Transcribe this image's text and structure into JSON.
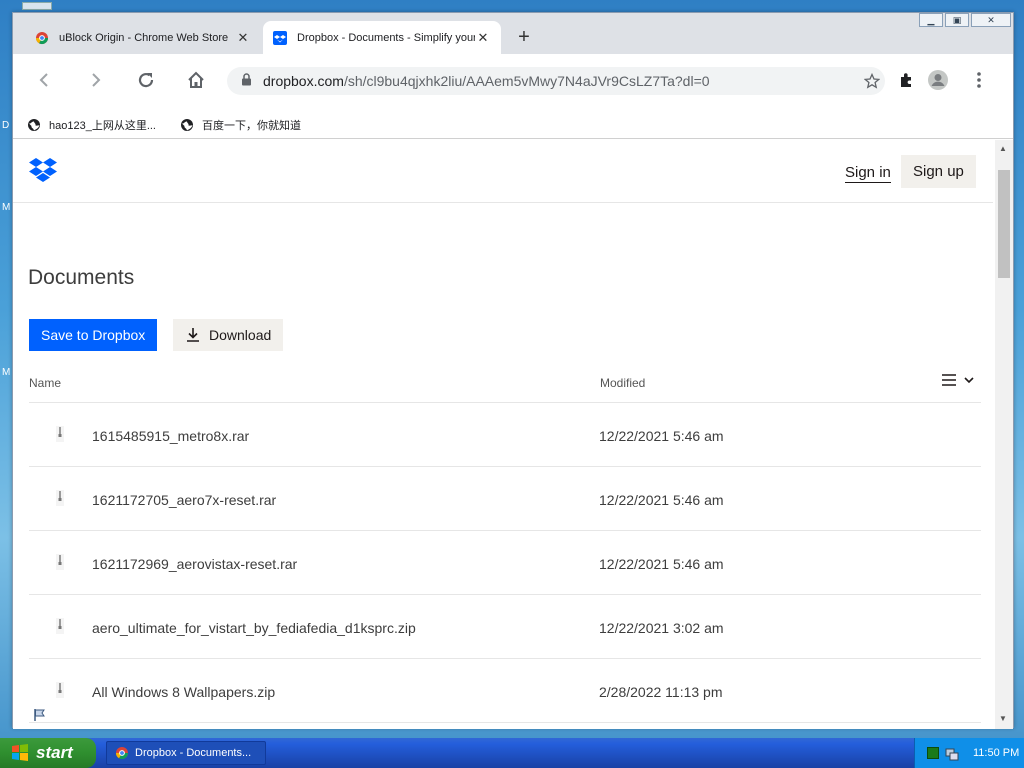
{
  "browser": {
    "tabs": [
      {
        "title": "uBlock Origin - Chrome Web Store",
        "active": false
      },
      {
        "title": "Dropbox - Documents - Simplify your",
        "active": true
      }
    ],
    "new_tab": "+",
    "url_host": "dropbox.com",
    "url_path": "/sh/cl9bu4qjxhk2liu/AAAem5vMwy7N4aJVr9CsLZ7Ta?dl=0",
    "bookmarks": [
      {
        "label": "hao123_上网从这里..."
      },
      {
        "label": "百度一下，你就知道"
      }
    ]
  },
  "dropbox": {
    "sign_in": "Sign in",
    "sign_up": "Sign up",
    "title": "Documents",
    "save_button": "Save to Dropbox",
    "download_button": "Download",
    "columns": {
      "name": "Name",
      "modified": "Modified"
    },
    "files": [
      {
        "name": "1615485915_metro8x.rar",
        "modified": "12/22/2021 5:46 am"
      },
      {
        "name": "1621172705_aero7x-reset.rar",
        "modified": "12/22/2021 5:46 am"
      },
      {
        "name": "1621172969_aerovistax-reset.rar",
        "modified": "12/22/2021 5:46 am"
      },
      {
        "name": "aero_ultimate_for_vistart_by_fediafedia_d1ksprc.zip",
        "modified": "12/22/2021 3:02 am"
      },
      {
        "name": "All Windows 8 Wallpapers.zip",
        "modified": "2/28/2022 11:13 pm"
      }
    ]
  },
  "taskbar": {
    "start": "start",
    "task_label": "Dropbox - Documents...",
    "clock": "11:50 PM"
  },
  "colors": {
    "dropbox_blue": "#0061fe",
    "xp_taskbar": "#245edb",
    "xp_start_green": "#2f8f2f"
  }
}
